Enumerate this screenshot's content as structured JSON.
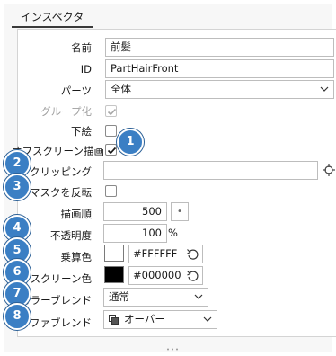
{
  "panel": {
    "tab_label": "インスペクタ"
  },
  "fields": {
    "name": {
      "label": "名前",
      "value": "前髪"
    },
    "id": {
      "label": "ID",
      "value": "PartHairFront"
    },
    "parts": {
      "label": "パーツ",
      "value": "全体"
    },
    "group": {
      "label": "グループ化",
      "checked": true,
      "disabled": true
    },
    "lower": {
      "label": "下絵",
      "checked": false
    },
    "offscreen": {
      "label": "オフスクリーン描画",
      "checked": true
    },
    "clipping": {
      "label": "クリッピング",
      "value": ""
    },
    "invert_mask": {
      "label": "マスクを反転",
      "checked": false
    },
    "draw_order": {
      "label": "描画順",
      "value": "500",
      "stepper": "•"
    },
    "opacity": {
      "label": "不透明度",
      "value": "100",
      "unit": "%"
    },
    "multiply": {
      "label": "乗算色",
      "hex": "#FFFFFF",
      "swatch": "#ffffff"
    },
    "screen": {
      "label": "スクリーン色",
      "hex": "#000000",
      "swatch": "#000000"
    },
    "color_blend": {
      "label": "カラーブレンド",
      "value": "通常"
    },
    "alpha_blend": {
      "label": "アルファブレンド",
      "value": "オーバー"
    }
  },
  "badges": [
    "1",
    "2",
    "3",
    "4",
    "5",
    "6",
    "7",
    "8"
  ],
  "colors": {
    "badge": "#3b7fc4",
    "check": "#1a1a1a",
    "disabled_text": "#a0a0a0"
  }
}
